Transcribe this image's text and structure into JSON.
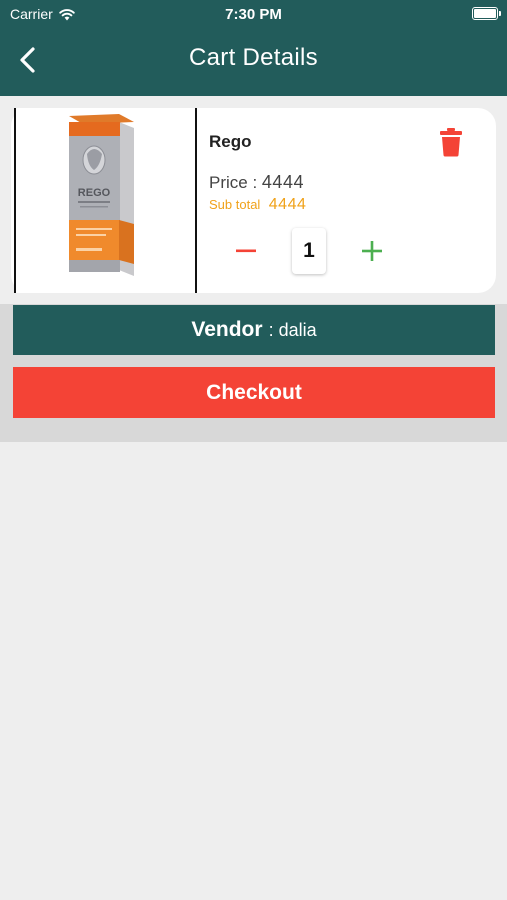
{
  "status_bar": {
    "carrier": "Carrier",
    "time": "7:30 PM"
  },
  "header": {
    "title": "Cart Details",
    "background_color": "#225c5b",
    "back_icon": "chevron-left-icon"
  },
  "cart": {
    "items": [
      {
        "name": "Rego",
        "price_label": "Price :",
        "price": "4444",
        "subtotal_label": "Sub total",
        "subtotal": "4444",
        "quantity": "1",
        "delete_icon": "trash-icon",
        "decrease_icon": "minus-icon",
        "increase_icon": "plus-icon",
        "product_image_icon": "product-box-image",
        "product_image_text": "REGO"
      }
    ]
  },
  "vendor": {
    "label": "Vendor",
    "separator": ":",
    "name": "dalia"
  },
  "checkout": {
    "label": "Checkout",
    "color": "#f44336"
  },
  "colors": {
    "accent": "#225c5b",
    "danger": "#f44336",
    "subtotal": "#f0a21a",
    "increase": "#4caf50"
  }
}
